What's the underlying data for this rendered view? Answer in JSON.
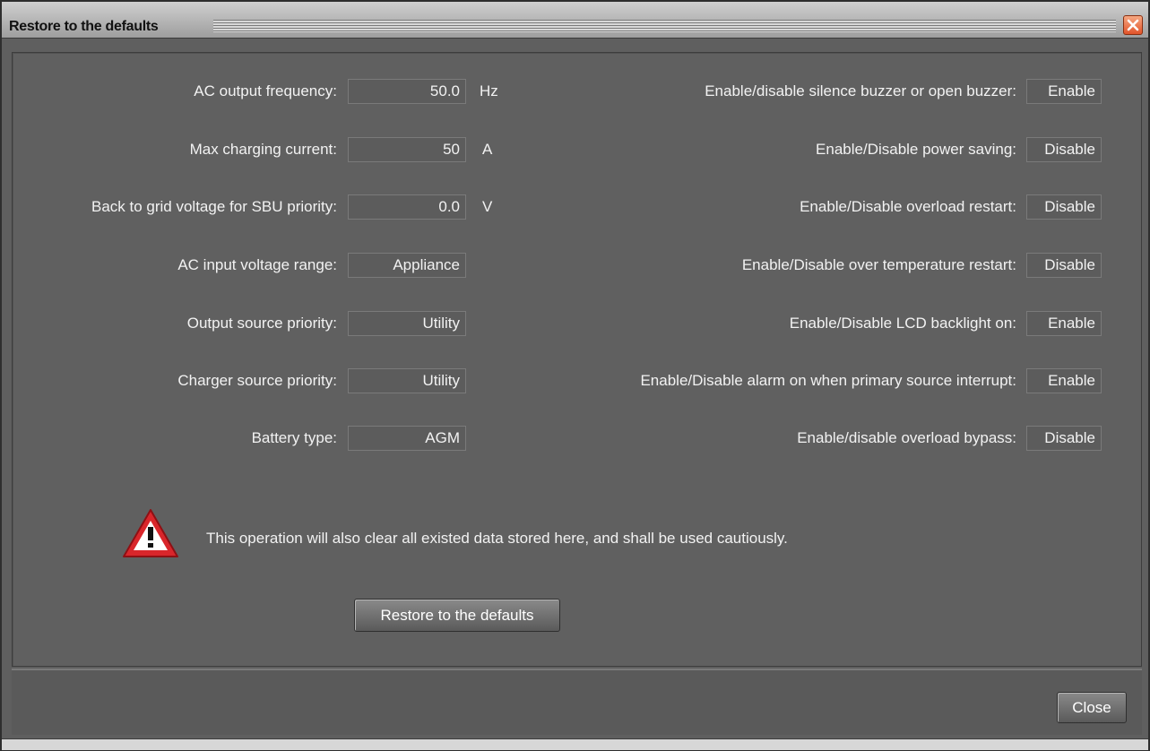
{
  "window": {
    "title": "Restore to the defaults"
  },
  "left_settings": [
    {
      "label": "AC output frequency:",
      "value": "50.0",
      "unit": "Hz"
    },
    {
      "label": "Max charging current:",
      "value": "50",
      "unit": "A"
    },
    {
      "label": "Back to grid voltage for SBU priority:",
      "value": "0.0",
      "unit": "V"
    },
    {
      "label": "AC input voltage range:",
      "value": "Appliance",
      "unit": ""
    },
    {
      "label": "Output source priority:",
      "value": "Utility",
      "unit": ""
    },
    {
      "label": "Charger source priority:",
      "value": "Utility",
      "unit": ""
    },
    {
      "label": "Battery type:",
      "value": "AGM",
      "unit": ""
    }
  ],
  "right_settings": [
    {
      "label": "Enable/disable silence buzzer or open buzzer:",
      "value": "Enable"
    },
    {
      "label": "Enable/Disable power saving:",
      "value": "Disable"
    },
    {
      "label": "Enable/Disable overload restart:",
      "value": "Disable"
    },
    {
      "label": "Enable/Disable over temperature restart:",
      "value": "Disable"
    },
    {
      "label": "Enable/Disable LCD backlight on:",
      "value": "Enable"
    },
    {
      "label": "Enable/Disable alarm on when primary source interrupt:",
      "value": "Enable"
    },
    {
      "label": "Enable/disable overload bypass:",
      "value": "Disable"
    }
  ],
  "warning": {
    "icon": "warning-triangle-icon",
    "text": "This operation will also clear all existed data stored here, and shall be used cautiously."
  },
  "buttons": {
    "restore_label": "Restore to the defaults",
    "close_label": "Close"
  },
  "colors": {
    "panel_bg": "#606060",
    "close_accent": "#e2542a",
    "warning_red": "#d9262b"
  }
}
